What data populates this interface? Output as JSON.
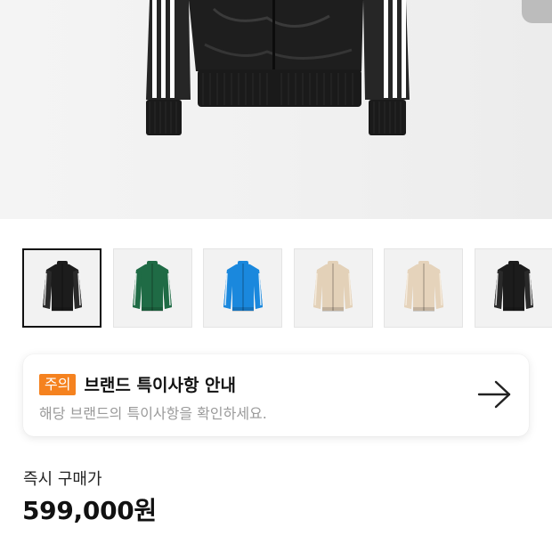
{
  "product": {
    "images": [
      {
        "name": "black",
        "colors": {
          "body": "#1c1c1c",
          "sleeve": "#2a2a2a",
          "stripe": "#ffffff"
        }
      },
      {
        "name": "green",
        "colors": {
          "body": "#1f6b45",
          "sleeve": "#1f6b45",
          "stripe": "#ffffff"
        }
      },
      {
        "name": "blue",
        "colors": {
          "body": "#1a88dd",
          "sleeve": "#1a88dd",
          "stripe": "#ffffff"
        }
      },
      {
        "name": "beige",
        "colors": {
          "body": "#e3d1b8",
          "sleeve": "#e3d1b8",
          "stripe": "#f7efe2"
        }
      },
      {
        "name": "beige-2",
        "colors": {
          "body": "#e5d3bb",
          "sleeve": "#e5d3bb",
          "stripe": "#f8f0e4"
        }
      },
      {
        "name": "black-2",
        "colors": {
          "body": "#1c1c1c",
          "sleeve": "#2a2a2a",
          "stripe": "#ffffff"
        }
      }
    ],
    "selected_image_index": 0
  },
  "notice": {
    "badge": "주의",
    "title": "브랜드 특이사항 안내",
    "description": "해당 브랜드의 특이사항을 확인하세요.",
    "arrow_icon": "arrow-right-icon"
  },
  "price": {
    "label": "즉시 구매가",
    "value": "599,000원"
  },
  "colors": {
    "badge": "#f5821f",
    "text_primary": "#111111",
    "text_muted": "#9a9a9a"
  }
}
